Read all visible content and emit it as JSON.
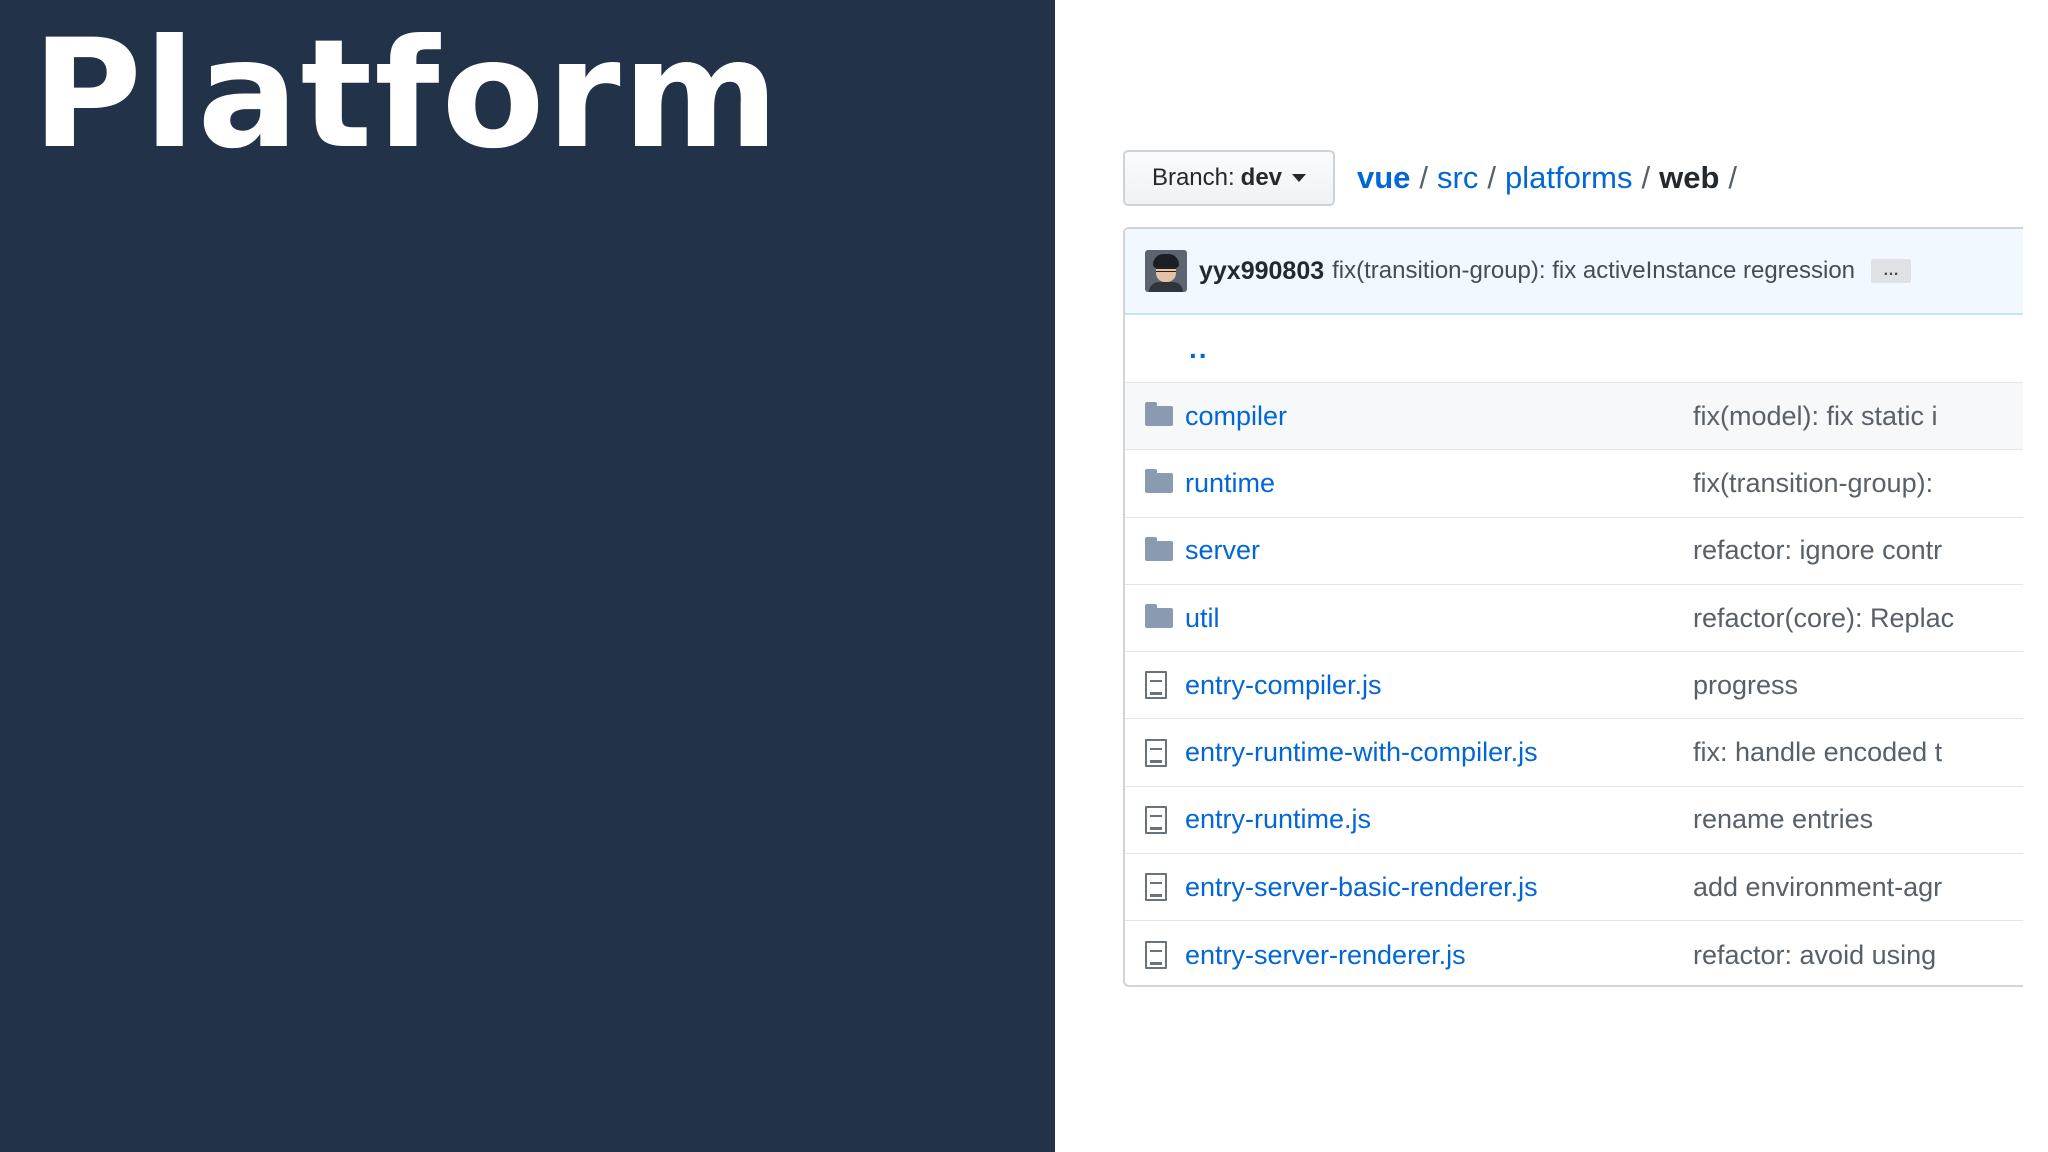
{
  "slide": {
    "title": "Platform"
  },
  "branch": {
    "label": "Branch:",
    "value": "dev"
  },
  "breadcrumb": {
    "items": [
      "vue",
      "src",
      "platforms",
      "web"
    ],
    "separator": "/"
  },
  "latest_commit": {
    "author": "yyx990803",
    "message": "fix(transition-group): fix activeInstance regression",
    "more": "…"
  },
  "parent_dir": "..",
  "files": [
    {
      "type": "folder",
      "name": "compiler",
      "message": "fix(model): fix static i"
    },
    {
      "type": "folder",
      "name": "runtime",
      "message": "fix(transition-group):"
    },
    {
      "type": "folder",
      "name": "server",
      "message": "refactor: ignore contr"
    },
    {
      "type": "folder",
      "name": "util",
      "message": "refactor(core): Replac"
    },
    {
      "type": "file",
      "name": "entry-compiler.js",
      "message": "progress"
    },
    {
      "type": "file",
      "name": "entry-runtime-with-compiler.js",
      "message": "fix: handle encoded t"
    },
    {
      "type": "file",
      "name": "entry-runtime.js",
      "message": "rename entries"
    },
    {
      "type": "file",
      "name": "entry-server-basic-renderer.js",
      "message": "add environment-agr"
    },
    {
      "type": "file",
      "name": "entry-server-renderer.js",
      "message": "refactor: avoid using"
    }
  ],
  "colors": {
    "slide_background": "#223248",
    "link": "#0366d6",
    "commit_bar": "#f1f8ff",
    "folder_icon": "#8a9ab0"
  }
}
